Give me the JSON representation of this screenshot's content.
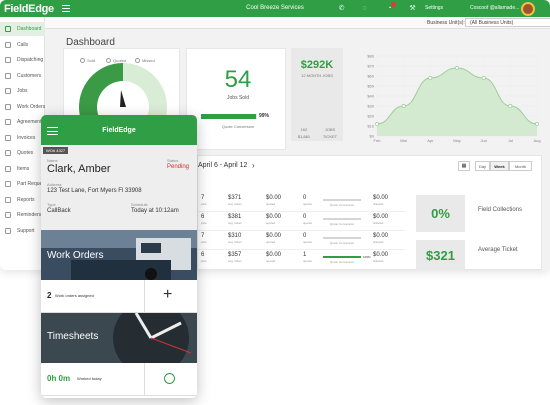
{
  "topbar": {
    "logo": "FieldEdge",
    "company": "Cool Breeze Services",
    "settings_label": "Settings",
    "user_label": "Coscoof @allamade..."
  },
  "subbar": {
    "label": "Business Unit(s):",
    "value": "(All Business Units)"
  },
  "sidebar": {
    "items": [
      {
        "label": "Dashboard",
        "active": true
      },
      {
        "label": "Calls"
      },
      {
        "label": "Dispatching"
      },
      {
        "label": "Customers"
      },
      {
        "label": "Jobs"
      },
      {
        "label": "Work Orders"
      },
      {
        "label": "Agreements"
      },
      {
        "label": "Invoices"
      },
      {
        "label": "Quotes"
      },
      {
        "label": "Items"
      },
      {
        "label": "Part Requests"
      },
      {
        "label": "Reports"
      },
      {
        "label": "Reminders"
      },
      {
        "label": "Support"
      }
    ]
  },
  "main": {
    "page_title": "Dashboard"
  },
  "pie_card": {
    "legend": [
      "Sold",
      "Quoted",
      "Missed"
    ],
    "sold_fraction": 0.45,
    "colors": {
      "sold": "#3a9a45",
      "quoted": "#d9ecd5",
      "missed": "#f0f0f0"
    }
  },
  "jobs_card": {
    "value": "54",
    "label": "Jobs Sold",
    "conversion_pct": 99,
    "conversion_pct_text": "99%",
    "conversion_label": "Quote Conversion"
  },
  "revenue_card": {
    "value": "$292K",
    "label": "12 MONTH JOBS",
    "stat_left_top": "162",
    "stat_left_bottom": "$1,881",
    "stat_right_top": "JOBS",
    "stat_right_bottom": "TICKET"
  },
  "chart_data": {
    "type": "area",
    "x": [
      "Feb",
      "Mar",
      "Apr",
      "May",
      "Jun",
      "Jul",
      "Aug"
    ],
    "values": [
      12,
      30,
      58,
      68,
      58,
      30,
      12
    ],
    "ytick_labels": [
      "$80",
      "$70",
      "$60",
      "$50",
      "$40",
      "$30",
      "$20",
      "$10",
      "$0"
    ],
    "ylim": [
      0,
      80
    ],
    "grid": true,
    "color": "#2f9e44"
  },
  "schedule": {
    "date_range": "April 6 - April 12",
    "next": "›",
    "cal_icon": "calendar-icon",
    "range_buttons": [
      {
        "label": "Day"
      },
      {
        "label": "Week",
        "active": true
      },
      {
        "label": "Month"
      }
    ]
  },
  "table": {
    "rows": [
      {
        "jobs": "7",
        "jobs_sub": "jobs",
        "amount": "$371",
        "amount_sub": "avg. ticket",
        "col3": "$0.00",
        "col3_sub": "quoted",
        "col4": "0",
        "col4_sub": "quotes",
        "quote_pct": 0,
        "quote_pct_text": "",
        "quote_label": "Quote Conversion",
        "col6": "$0.00",
        "col6_sub": "ticketed"
      },
      {
        "jobs": "6",
        "jobs_sub": "jobs",
        "amount": "$381",
        "amount_sub": "avg. ticket",
        "col3": "$0.00",
        "col3_sub": "quoted",
        "col4": "0",
        "col4_sub": "quotes",
        "quote_pct": 0,
        "quote_pct_text": "",
        "quote_label": "Quote Conversion",
        "col6": "$0.00",
        "col6_sub": "ticketed"
      },
      {
        "jobs": "7",
        "jobs_sub": "jobs",
        "amount": "$310",
        "amount_sub": "avg. ticket",
        "col3": "$0.00",
        "col3_sub": "quoted",
        "col4": "0",
        "col4_sub": "quotes",
        "quote_pct": 0,
        "quote_pct_text": "",
        "quote_label": "Quote Conversion",
        "col6": "$0.00",
        "col6_sub": "ticketed"
      },
      {
        "jobs": "6",
        "jobs_sub": "jobs",
        "amount": "$357",
        "amount_sub": "avg. ticket",
        "col3": "$0.00",
        "col3_sub": "quoted",
        "col4": "1",
        "col4_sub": "quotes",
        "quote_pct": 100,
        "quote_pct_text": "100%",
        "quote_label": "Quote Conversion",
        "col6": "$0.00",
        "col6_sub": "ticketed"
      }
    ]
  },
  "metrics": [
    {
      "value": "0%",
      "label": "Field Collections"
    },
    {
      "value": "$321",
      "label": "Average Ticket"
    }
  ],
  "phone": {
    "title": "FieldEdge",
    "wo_tag": "WO# 4327",
    "name_label": "Name",
    "name": "Clark, Amber",
    "status_label": "Status",
    "status": "Pending",
    "address_label": "Address",
    "address": "123 Test Lane, Fort Myers Fl 33908",
    "type_label": "Type",
    "type": "CallBack",
    "schedule_label": "Schedule",
    "schedule": "Today at 10:12am",
    "work_orders": {
      "title": "Work Orders",
      "count": "2",
      "count_label": "Work orders assigned",
      "action": "+"
    },
    "timesheets": {
      "title": "Timesheets",
      "hours": "0h 0m",
      "hours_label": "Worked today"
    }
  }
}
